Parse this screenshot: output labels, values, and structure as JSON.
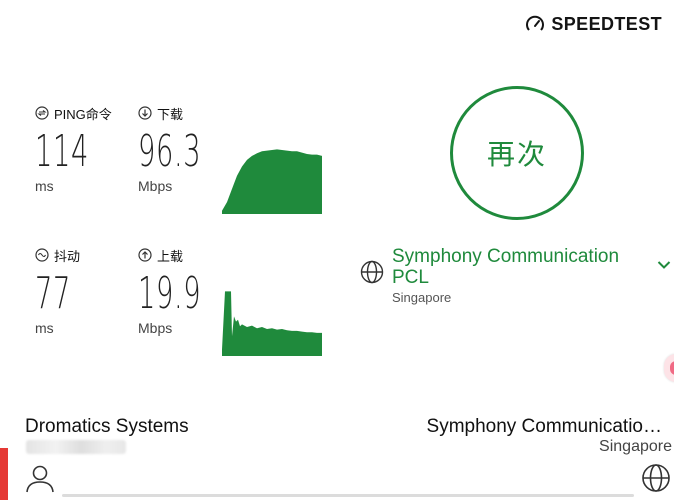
{
  "brand": {
    "name": "SPEEDTEST",
    "icon": "speedometer-icon"
  },
  "metrics": {
    "ping": {
      "label": "PING命令",
      "value": "114",
      "unit": "ms",
      "icon": "ping-icon"
    },
    "download": {
      "label": "下载",
      "value": "96.3",
      "unit": "Mbps",
      "icon": "download-arrow-icon"
    },
    "jitter": {
      "label": "抖动",
      "value": "77",
      "unit": "ms",
      "icon": "jitter-icon"
    },
    "upload": {
      "label": "上载",
      "value": "19.9",
      "unit": "Mbps",
      "icon": "upload-arrow-icon"
    }
  },
  "go_button": {
    "label": "再次"
  },
  "server": {
    "name": "Symphony Communication PCL",
    "location": "Singapore",
    "icon": "globe-icon"
  },
  "footer": {
    "isp_name": "Dromatics Systems",
    "host_name": "Symphony Communicatio…",
    "host_location": "Singapore"
  },
  "colors": {
    "accent_green": "#1f8a3c",
    "chart_fill": "#1f8a3c",
    "brand_red": "#e53935"
  },
  "chart_data": [
    {
      "type": "area",
      "x": [
        0,
        5,
        10,
        15,
        20,
        25,
        30,
        35,
        40,
        45,
        50,
        55,
        60,
        65,
        70,
        75,
        80,
        85,
        90,
        95,
        100
      ],
      "values": [
        0.05,
        0.18,
        0.38,
        0.58,
        0.72,
        0.82,
        0.88,
        0.92,
        0.95,
        0.96,
        0.97,
        0.98,
        0.97,
        0.96,
        0.95,
        0.95,
        0.93,
        0.91,
        0.9,
        0.9,
        0.88
      ]
    },
    {
      "type": "area",
      "x": [
        0,
        3,
        6,
        9,
        10,
        12,
        14,
        16,
        18,
        20,
        25,
        30,
        35,
        40,
        45,
        50,
        55,
        60,
        65,
        70,
        75,
        80,
        85,
        90,
        95,
        100
      ],
      "values": [
        0.1,
        0.98,
        0.98,
        0.98,
        0.3,
        0.6,
        0.52,
        0.55,
        0.45,
        0.48,
        0.44,
        0.46,
        0.42,
        0.44,
        0.41,
        0.42,
        0.4,
        0.41,
        0.39,
        0.38,
        0.38,
        0.37,
        0.36,
        0.36,
        0.35,
        0.35
      ]
    }
  ]
}
